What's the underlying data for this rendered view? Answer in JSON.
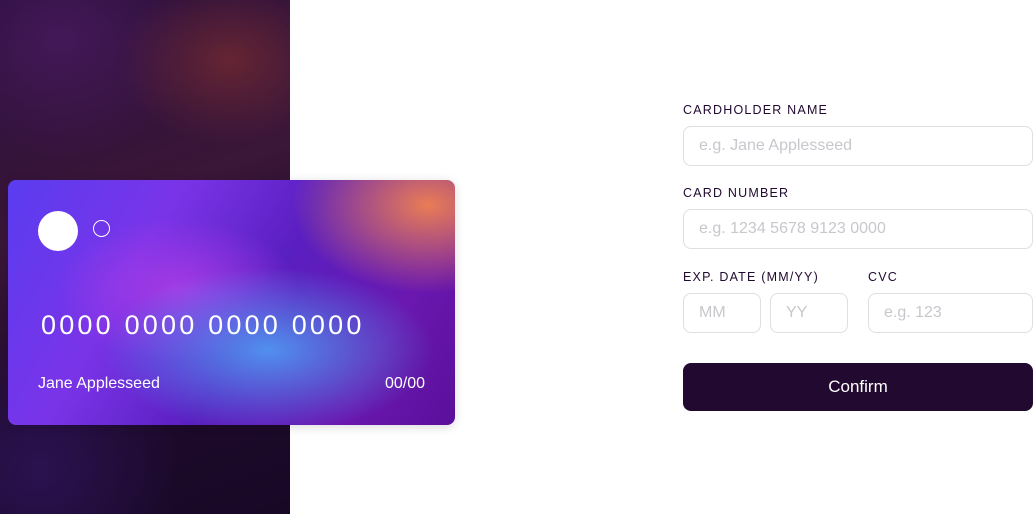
{
  "card": {
    "number": "0000 0000 0000 0000",
    "name": "Jane Applesseed",
    "expiry": "00/00"
  },
  "form": {
    "cardholder": {
      "label": "CARDHOLDER NAME",
      "placeholder": "e.g. Jane Applesseed",
      "value": ""
    },
    "card_number": {
      "label": "CARD NUMBER",
      "placeholder": "e.g. 1234 5678 9123 0000",
      "value": ""
    },
    "exp_date": {
      "label": "EXP. DATE (MM/YY)",
      "month_placeholder": "MM",
      "year_placeholder": "YY"
    },
    "cvc": {
      "label": "CVC",
      "placeholder": "e.g. 123",
      "value": ""
    },
    "confirm_label": "Confirm"
  },
  "colors": {
    "primary_dark": "#21092f",
    "input_border": "#dfdee0",
    "placeholder": "#c9c6cc"
  }
}
